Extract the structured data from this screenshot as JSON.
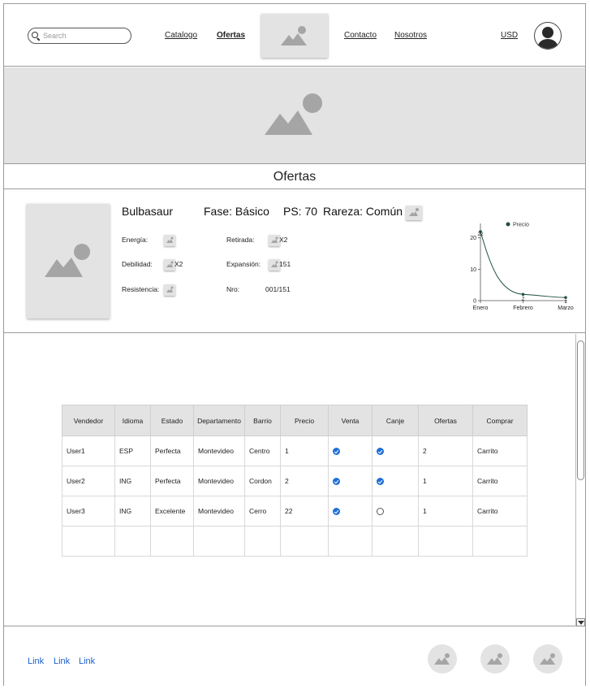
{
  "header": {
    "search": {
      "placeholder": "Search",
      "value": ""
    },
    "nav": [
      {
        "label": "Catalogo",
        "active": false
      },
      {
        "label": "Ofertas",
        "active": true
      },
      {
        "label": "Contacto",
        "active": false
      },
      {
        "label": "Nosotros",
        "active": false
      }
    ],
    "logo_icon": "image-placeholder-icon",
    "currency": "USD",
    "avatar_icon": "user-avatar-icon"
  },
  "banner": {
    "icon": "image-placeholder-icon"
  },
  "section_title": "Ofertas",
  "card": {
    "name": "Bulbasaur",
    "fase": "Fase: Básico",
    "ps": "PS: 70",
    "rareza": "Rareza: Común",
    "attributes": {
      "energia_label": "Energía:",
      "debilidad_label": "Debilidad:",
      "debilidad_value": "X2",
      "resistencia_label": "Resistencia:",
      "retirada_label": "Retirada:",
      "retirada_value": "X2",
      "expansion_label": "Expansión:",
      "expansion_value": "151",
      "nro_label": "Nro:",
      "nro_value": "001/151"
    }
  },
  "chart_data": {
    "type": "line",
    "categories": [
      "Enero",
      "Febrero",
      "Marzo"
    ],
    "series": [
      {
        "name": "Precio",
        "values": [
          22,
          2,
          1
        ],
        "color": "#1f4f3f"
      }
    ],
    "data_labels": [
      "22",
      "2",
      "1"
    ],
    "yticks": [
      "0",
      "10",
      "20"
    ],
    "ylim": [
      0,
      22
    ],
    "legend": "top-right"
  },
  "table": {
    "columns": [
      "Vendedor",
      "Idioma",
      "Estado",
      "Departamento",
      "Barrio",
      "Precio",
      "Venta",
      "Canje",
      "Ofertas",
      "Comprar"
    ],
    "rows": [
      {
        "vendedor": "User1",
        "idioma": "ESP",
        "estado": "Perfecta",
        "departamento": "Montevideo",
        "barrio": "Centro",
        "precio": "1",
        "venta": true,
        "canje": true,
        "ofertas": "2",
        "comprar": "Carrito"
      },
      {
        "vendedor": "User2",
        "idioma": "ING",
        "estado": "Perfecta",
        "departamento": "Montevideo",
        "barrio": "Cordon",
        "precio": "2",
        "venta": true,
        "canje": true,
        "ofertas": "1",
        "comprar": "Carrito"
      },
      {
        "vendedor": "User3",
        "idioma": "ING",
        "estado": "Excelente",
        "departamento": "Montevideo",
        "barrio": "Cerro",
        "precio": "22",
        "venta": true,
        "canje": false,
        "ofertas": "1",
        "comprar": "Carrito"
      }
    ]
  },
  "footer": {
    "links": [
      "Link",
      "Link",
      "Link"
    ],
    "social_icons": [
      "image-placeholder-icon",
      "image-placeholder-icon",
      "image-placeholder-icon"
    ],
    "link_color": "#1a5fd0"
  },
  "colors": {
    "placeholder_bg": "#e3e3e3",
    "check_on": "#1f6fd6"
  }
}
